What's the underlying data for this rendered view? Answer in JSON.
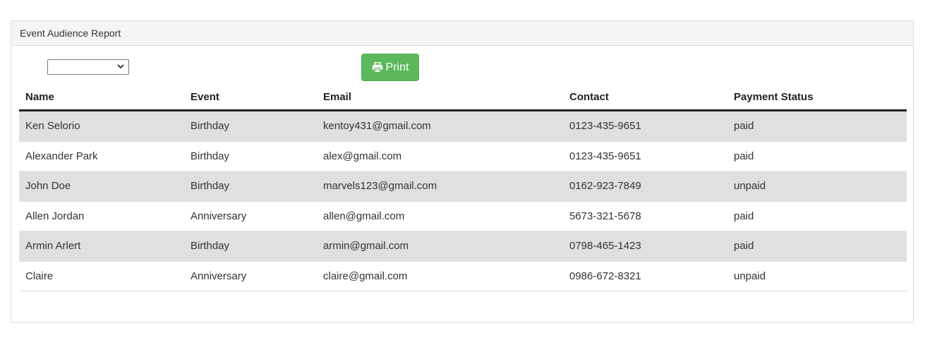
{
  "panel": {
    "title": "Event Audience Report"
  },
  "toolbar": {
    "filter_value": "",
    "print_label": "Print",
    "print_color": "#5cb85c"
  },
  "table": {
    "headers": {
      "name": "Name",
      "event": "Event",
      "email": "Email",
      "contact": "Contact",
      "payment": "Payment Status"
    },
    "rows": [
      {
        "name": "Ken Selorio",
        "event": "Birthday",
        "email": "kentoy431@gmail.com",
        "contact": "0123-435-9651",
        "payment": "paid"
      },
      {
        "name": "Alexander Park",
        "event": "Birthday",
        "email": "alex@gmail.com",
        "contact": "0123-435-9651",
        "payment": "paid"
      },
      {
        "name": "John Doe",
        "event": "Birthday",
        "email": "marvels123@gmail.com",
        "contact": "0162-923-7849",
        "payment": "unpaid"
      },
      {
        "name": "Allen Jordan",
        "event": "Anniversary",
        "email": "allen@gmail.com",
        "contact": "5673-321-5678",
        "payment": "paid"
      },
      {
        "name": "Armin Arlert",
        "event": "Birthday",
        "email": "armin@gmail.com",
        "contact": "0798-465-1423",
        "payment": "paid"
      },
      {
        "name": "Claire",
        "event": "Anniversary",
        "email": "claire@gmail.com",
        "contact": "0986-672-8321",
        "payment": "unpaid"
      }
    ]
  }
}
